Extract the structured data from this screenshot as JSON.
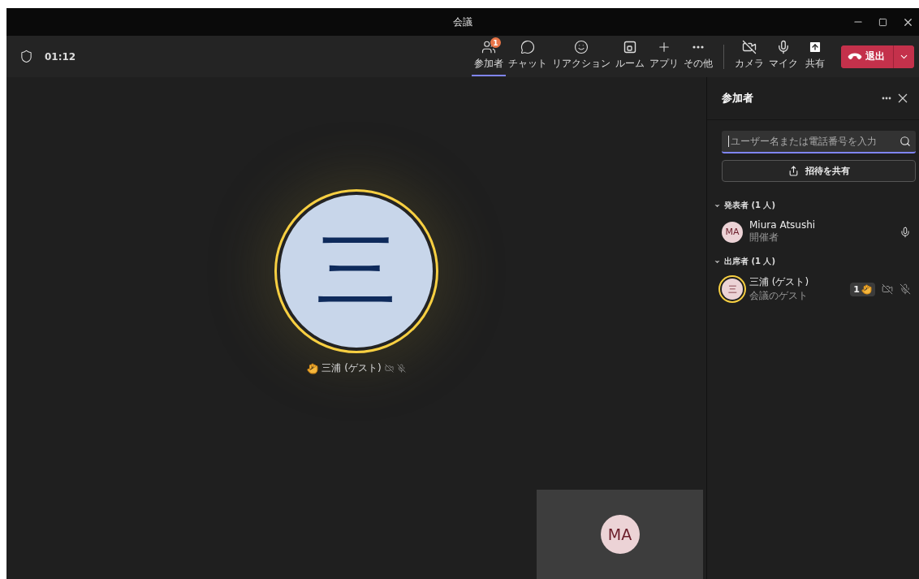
{
  "window": {
    "title": "会議"
  },
  "toolbar": {
    "timer": "01:12",
    "items": [
      {
        "kind": "people",
        "label": "参加者",
        "selected": true,
        "badge": "1"
      },
      {
        "kind": "chat",
        "label": "チャット",
        "selected": false
      },
      {
        "kind": "reaction",
        "label": "リアクション",
        "selected": false
      },
      {
        "kind": "room",
        "label": "ルーム",
        "selected": false
      },
      {
        "kind": "apps",
        "label": "アプリ",
        "selected": false
      },
      {
        "kind": "more",
        "label": "その他",
        "selected": false
      }
    ],
    "devices": [
      {
        "kind": "camera",
        "label": "カメラ",
        "off": true
      },
      {
        "kind": "mic",
        "label": "マイク",
        "off": false
      },
      {
        "kind": "share",
        "label": "共有",
        "off": false
      }
    ],
    "leave": {
      "label": "退出"
    }
  },
  "stage": {
    "tile": {
      "initial": "三",
      "name": "三浦 (ゲスト)",
      "highlighted": true,
      "hand_raised": true,
      "icons": [
        {
          "kind": "camera",
          "off": true
        },
        {
          "kind": "mic",
          "off": true
        }
      ]
    },
    "self_view": {
      "initials": "MA"
    }
  },
  "panel": {
    "title": "参加者",
    "search": {
      "placeholder": "ユーザー名または電話番号を入力"
    },
    "invite": "招待を共有",
    "groups": [
      {
        "title": "発表者 (1 人)",
        "expanded": true,
        "members": [
          {
            "initials": "MA",
            "name": "Miura Atsushi",
            "role": "開催者",
            "highlighted": false,
            "icons": [
              {
                "kind": "mic",
                "off": false
              }
            ]
          }
        ]
      },
      {
        "title": "出席者 (1 人)",
        "expanded": true,
        "members": [
          {
            "initials": "三",
            "name": "三浦 (ゲスト)",
            "role": "会議のゲスト",
            "highlighted": true,
            "hand": "1",
            "icons": [
              {
                "kind": "camera",
                "off": true
              },
              {
                "kind": "mic",
                "off": true
              }
            ]
          }
        ]
      }
    ]
  }
}
